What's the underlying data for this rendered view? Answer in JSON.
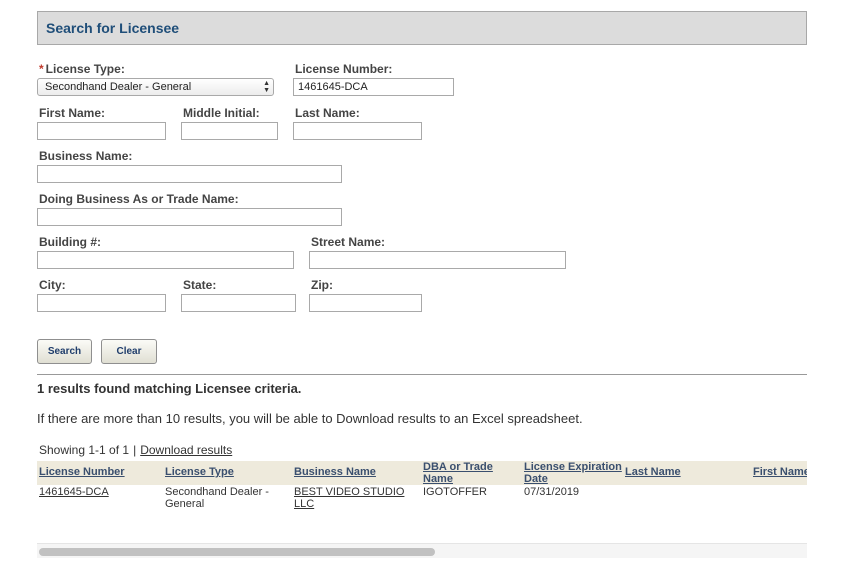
{
  "panel": {
    "title": "Search for Licensee"
  },
  "form": {
    "license_type": {
      "required_marker": "*",
      "label": "License Type:",
      "value": "Secondhand Dealer - General"
    },
    "license_number": {
      "label": "License Number:",
      "value": "1461645-DCA"
    },
    "first_name": {
      "label": "First Name:",
      "value": ""
    },
    "middle_initial": {
      "label": "Middle Initial:",
      "value": ""
    },
    "last_name": {
      "label": "Last Name:",
      "value": ""
    },
    "business_name": {
      "label": "Business Name:",
      "value": ""
    },
    "dba": {
      "label": "Doing Business As or Trade Name:",
      "value": ""
    },
    "building": {
      "label": "Building #:",
      "value": ""
    },
    "street": {
      "label": "Street Name:",
      "value": ""
    },
    "city": {
      "label": "City:",
      "value": ""
    },
    "state": {
      "label": "State:",
      "value": ""
    },
    "zip": {
      "label": "Zip:",
      "value": ""
    }
  },
  "buttons": {
    "search": "Search",
    "clear": "Clear"
  },
  "results": {
    "count_text": "1 results found matching Licensee criteria.",
    "info_text": "If there are more than 10 results, you will be able to Download results to an Excel spreadsheet.",
    "showing": "Showing 1-1 of 1",
    "separator": "|",
    "download_link": "Download results"
  },
  "table": {
    "headers": {
      "license_number": "License Number",
      "license_type": "License Type",
      "business_name": "Business Name",
      "dba_line1": "DBA or Trade",
      "dba_line2": "Name",
      "expiration_line1": "License Expiration",
      "expiration_line2": "Date",
      "last_name": "Last Name",
      "first_name": "First Name"
    },
    "row": {
      "license_number": "1461645-DCA",
      "license_type_line1": "Secondhand Dealer -",
      "license_type_line2": "General",
      "business_name_line1": "BEST VIDEO STUDIO",
      "business_name_line2": "LLC",
      "dba": "IGOTOFFER",
      "expiration": "07/31/2019"
    }
  }
}
